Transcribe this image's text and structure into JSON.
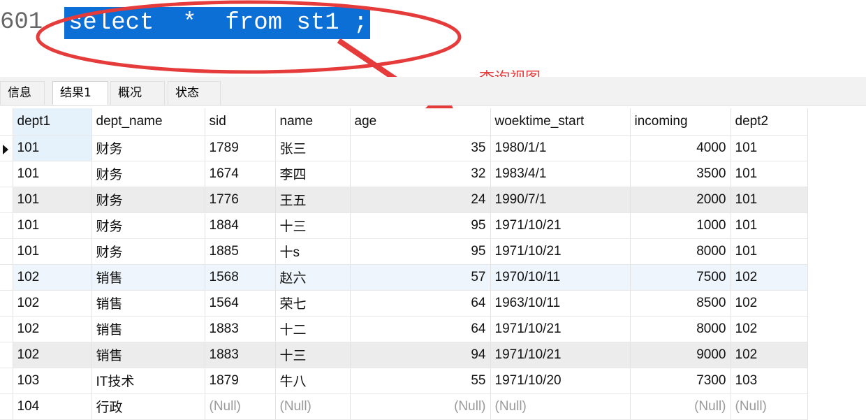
{
  "editor": {
    "line_number": "601",
    "sql_selected": "select  *  from st1 ;"
  },
  "annotation": {
    "label": "查询视图",
    "color": "#e53b3b"
  },
  "tabs": [
    {
      "label": "信息",
      "active": false
    },
    {
      "label": "结果1",
      "active": true
    },
    {
      "label": "概况",
      "active": false
    },
    {
      "label": "状态",
      "active": false
    }
  ],
  "grid": {
    "columns": [
      "dept1",
      "dept_name",
      "sid",
      "name",
      "age",
      "woektime_start",
      "incoming",
      "dept2"
    ],
    "rows": [
      [
        "101",
        "财务",
        "1789",
        "张三",
        "35",
        "1980/1/1",
        "4000",
        "101"
      ],
      [
        "101",
        "财务",
        "1674",
        "李四",
        "32",
        "1983/4/1",
        "3500",
        "101"
      ],
      [
        "101",
        "财务",
        "1776",
        "王五",
        "24",
        "1990/7/1",
        "2000",
        "101"
      ],
      [
        "101",
        "财务",
        "1884",
        "十三",
        "95",
        "1971/10/21",
        "1000",
        "101"
      ],
      [
        "101",
        "财务",
        "1885",
        "十s",
        "95",
        "1971/10/21",
        "8000",
        "101"
      ],
      [
        "102",
        "销售",
        "1568",
        "赵六",
        "57",
        "1970/10/11",
        "7500",
        "102"
      ],
      [
        "102",
        "销售",
        "1564",
        "荣七",
        "64",
        "1963/10/11",
        "8500",
        "102"
      ],
      [
        "102",
        "销售",
        "1883",
        "十二",
        "64",
        "1971/10/21",
        "8000",
        "102"
      ],
      [
        "102",
        "销售",
        "1883",
        "十三",
        "94",
        "1971/10/21",
        "9000",
        "102"
      ],
      [
        "103",
        "IT技术",
        "1879",
        "牛八",
        "55",
        "1971/10/20",
        "7300",
        "103"
      ],
      [
        "104",
        "行政",
        "(Null)",
        "(Null)",
        "(Null)",
        "(Null)",
        "(Null)",
        "(Null)"
      ]
    ]
  },
  "colors": {
    "selection": "#0b6fd6",
    "annotation_red": "#e53b3b",
    "selected_column": "#e6f2fb"
  }
}
